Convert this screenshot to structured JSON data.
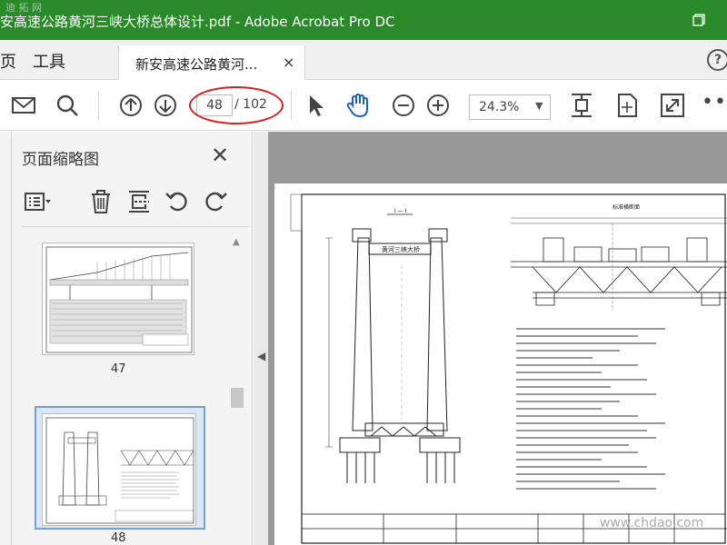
{
  "window": {
    "title": "安高速公路黄河三峡大桥总体设计.pdf - Adobe Acrobat Pro DC",
    "watermark": "迪 拓 网"
  },
  "tabs": {
    "home": "页",
    "tools": "工具",
    "document": "新安高速公路黄河...",
    "close": "×",
    "help": "?"
  },
  "toolbar": {
    "current_page": "48",
    "total_pages": "/ 102",
    "zoom": "24.3%",
    "zoom_caret": "▼",
    "more": "•••",
    "icons": [
      "mail-icon",
      "search-icon",
      "page-up-icon",
      "page-down-icon",
      "select-cursor-icon",
      "hand-tool-icon",
      "zoom-out-icon",
      "zoom-in-icon",
      "fit-page-icon",
      "rotate-view-icon",
      "full-screen-icon"
    ]
  },
  "sidebar": {
    "title": "页面缩略图",
    "close": "✕",
    "tools": [
      "page-options-icon",
      "delete-icon",
      "extract-icon",
      "undo-icon",
      "redo-icon"
    ],
    "thumbnails": [
      {
        "label": "47"
      },
      {
        "label": "48",
        "selected": true
      }
    ]
  },
  "document": {
    "drawing_title": "黄河三峡大桥",
    "section_label": "I — I",
    "side_title": "标准横断面",
    "footer_watermark": "www.chdao.com"
  },
  "colors": {
    "titlebar": "#2a8a2a",
    "accent_blue": "#1a63c0",
    "annotation_red": "#d42020"
  }
}
